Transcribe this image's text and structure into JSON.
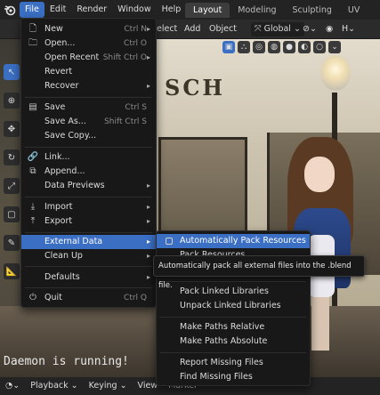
{
  "topbar": {
    "menus": [
      "File",
      "Edit",
      "Render",
      "Window",
      "Help"
    ],
    "workspace_tabs": [
      "Layout",
      "Modeling",
      "Sculpting",
      "UV Editing"
    ]
  },
  "header": {
    "select": "elect",
    "add": "Add",
    "object": "Object",
    "transform": "Global"
  },
  "viewport": {
    "sign_text": "SCH",
    "status_text": "Daemon is running!"
  },
  "bottombar": {
    "playback": "Playback",
    "keying": "Keying",
    "view": "View",
    "marker": "Marker"
  },
  "file_menu": {
    "items": [
      {
        "label": "New",
        "shortcut": "Ctrl N",
        "icon": "new-file-icon"
      },
      {
        "label": "Open...",
        "shortcut": "Ctrl O",
        "icon": "folder-icon"
      },
      {
        "label": "Open Recent",
        "shortcut": "Shift Ctrl O",
        "icon": ""
      },
      {
        "label": "Revert",
        "shortcut": "",
        "icon": ""
      },
      {
        "label": "Recover",
        "shortcut": "",
        "icon": ""
      },
      {
        "label": "Save",
        "shortcut": "Ctrl S",
        "icon": "save-icon"
      },
      {
        "label": "Save As...",
        "shortcut": "Shift Ctrl S",
        "icon": ""
      },
      {
        "label": "Save Copy...",
        "shortcut": "",
        "icon": ""
      },
      {
        "label": "Link...",
        "shortcut": "",
        "icon": "link-icon"
      },
      {
        "label": "Append...",
        "shortcut": "",
        "icon": "append-icon"
      },
      {
        "label": "Data Previews",
        "shortcut": "",
        "icon": ""
      },
      {
        "label": "Import",
        "shortcut": "",
        "icon": "import-icon"
      },
      {
        "label": "Export",
        "shortcut": "",
        "icon": "export-icon"
      },
      {
        "label": "External Data",
        "shortcut": "",
        "icon": ""
      },
      {
        "label": "Clean Up",
        "shortcut": "",
        "icon": ""
      },
      {
        "label": "Defaults",
        "shortcut": "",
        "icon": ""
      },
      {
        "label": "Quit",
        "shortcut": "Ctrl Q",
        "icon": "power-icon"
      }
    ]
  },
  "external_data_menu": {
    "items": [
      "Automatically Pack Resources",
      "Pack Resources",
      "Pack Linked Libraries",
      "Unpack Linked Libraries",
      "Make Paths Relative",
      "Make Paths Absolute",
      "Report Missing Files",
      "Find Missing Files"
    ],
    "tooltip": "Automatically pack all external files into the .blend file."
  },
  "colors": {
    "accent": "#3b6fc4",
    "menu_bg": "#181818",
    "topbar_bg": "#232323"
  }
}
